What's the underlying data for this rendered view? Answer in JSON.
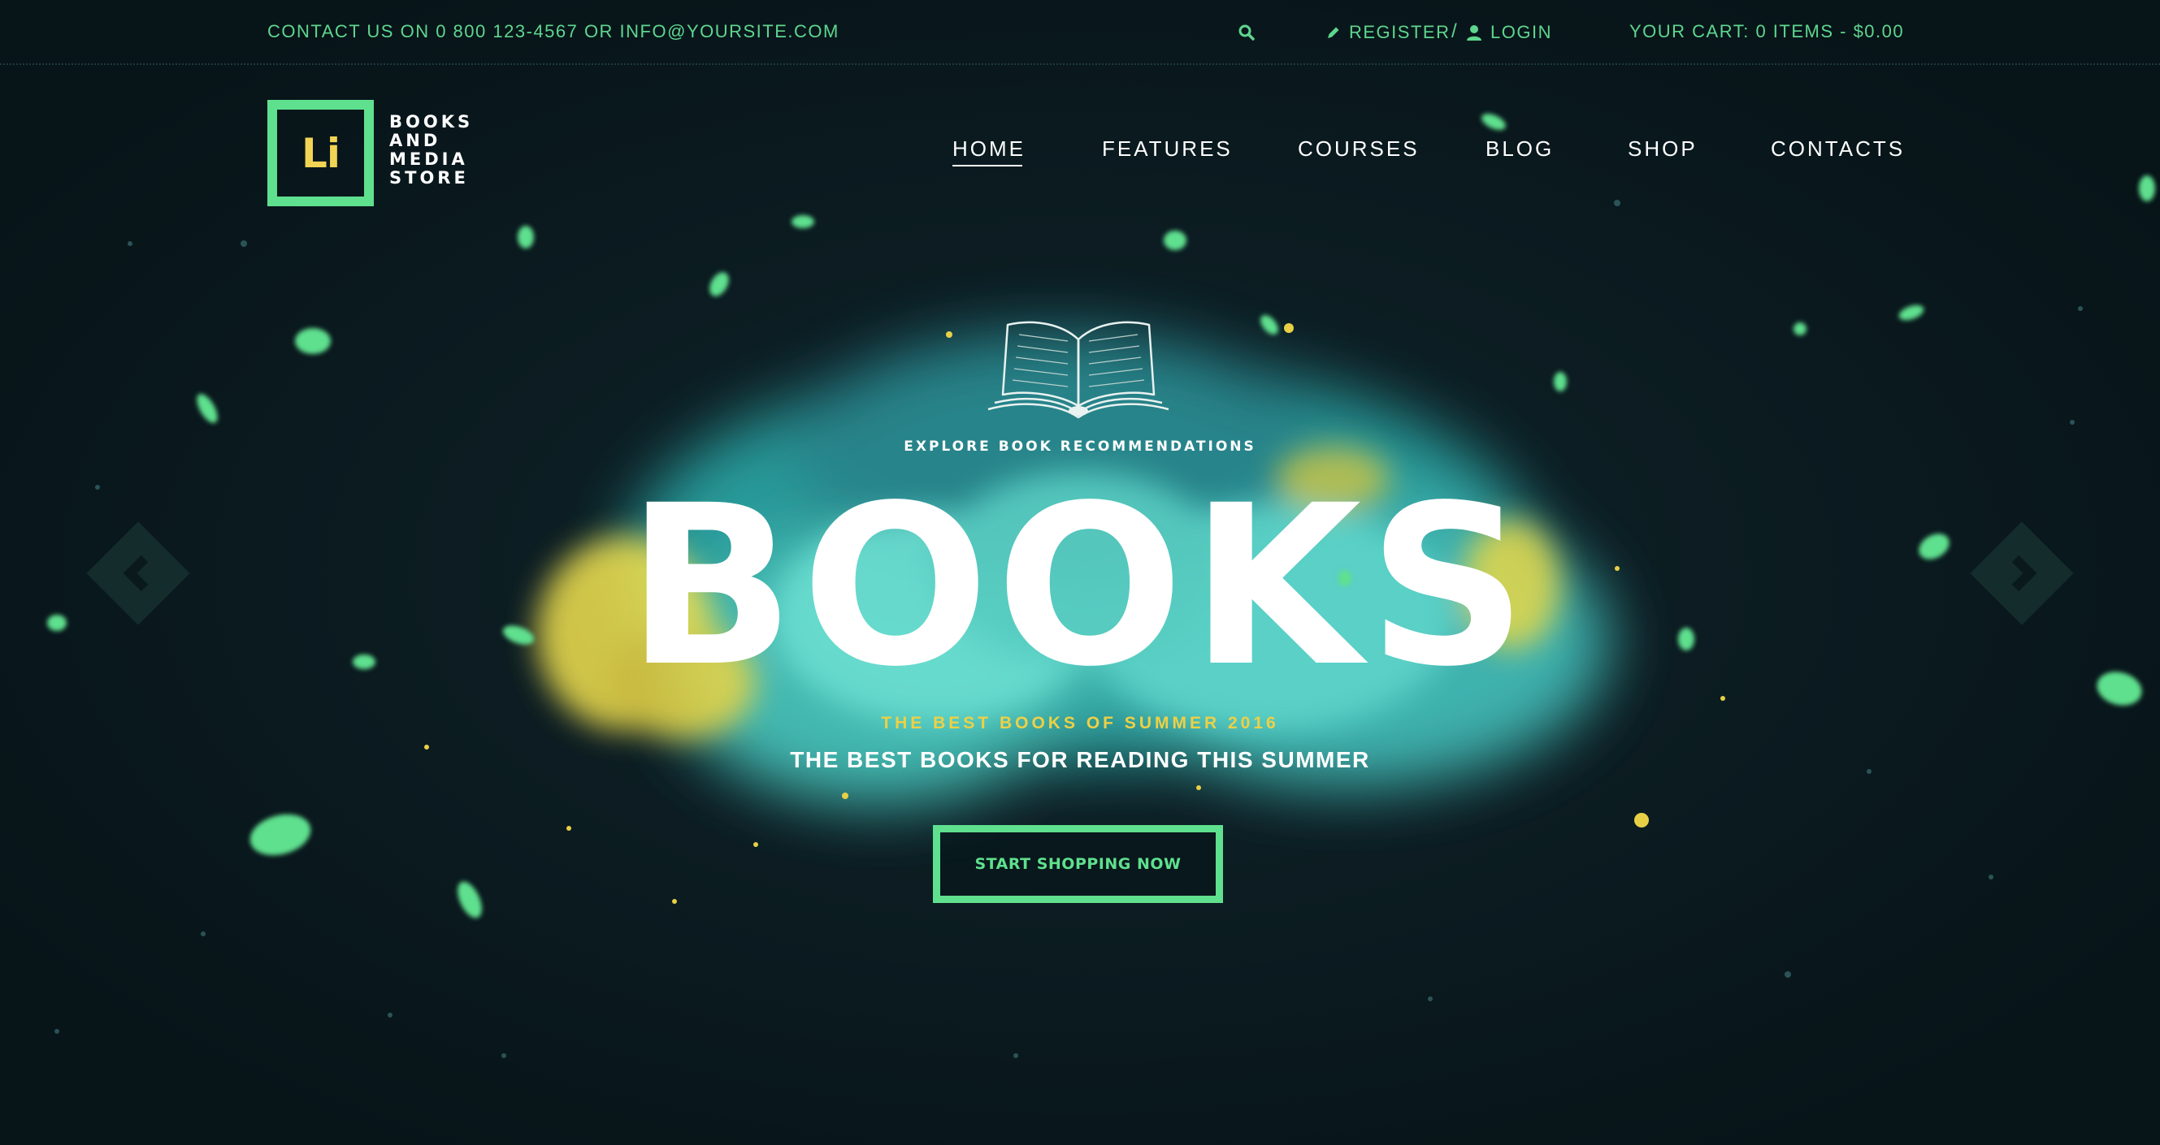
{
  "topbar": {
    "contact": "CONTACT US ON 0 800 123-4567 OR INFO@YOURSITE.COM",
    "register": "REGISTER",
    "separator": "/",
    "login": "LOGIN",
    "cart": "YOUR CART: 0 ITEMS - $0.00"
  },
  "logo": {
    "mark": "Li",
    "lines": [
      "BOOKS",
      "AND",
      "MEDIA",
      "STORE"
    ]
  },
  "nav": {
    "items": [
      {
        "label": "HOME",
        "active": true
      },
      {
        "label": "FEATURES",
        "active": false
      },
      {
        "label": "COURSES",
        "active": false
      },
      {
        "label": "BLOG",
        "active": false
      },
      {
        "label": "SHOP",
        "active": false
      },
      {
        "label": "CONTACTS",
        "active": false
      }
    ]
  },
  "hero": {
    "eyebrow": "EXPLORE BOOK RECOMMENDATIONS",
    "title": "BOOKS",
    "tagline": "THE BEST BOOKS OF SUMMER 2016",
    "subtitle": "THE BEST BOOKS FOR READING THIS SUMMER",
    "cta": "START SHOPPING NOW"
  },
  "icons": {
    "search": "search-icon",
    "register": "pencil-icon",
    "login": "user-icon",
    "book": "open-book-icon",
    "prev": "chevron-left-icon",
    "next": "chevron-right-icon"
  },
  "colors": {
    "background": "#0a1a20",
    "accent_green": "#5fe08e",
    "accent_yellow": "#eed045",
    "cloud_teal": "#4fd0c4",
    "text": "#ffffff"
  }
}
